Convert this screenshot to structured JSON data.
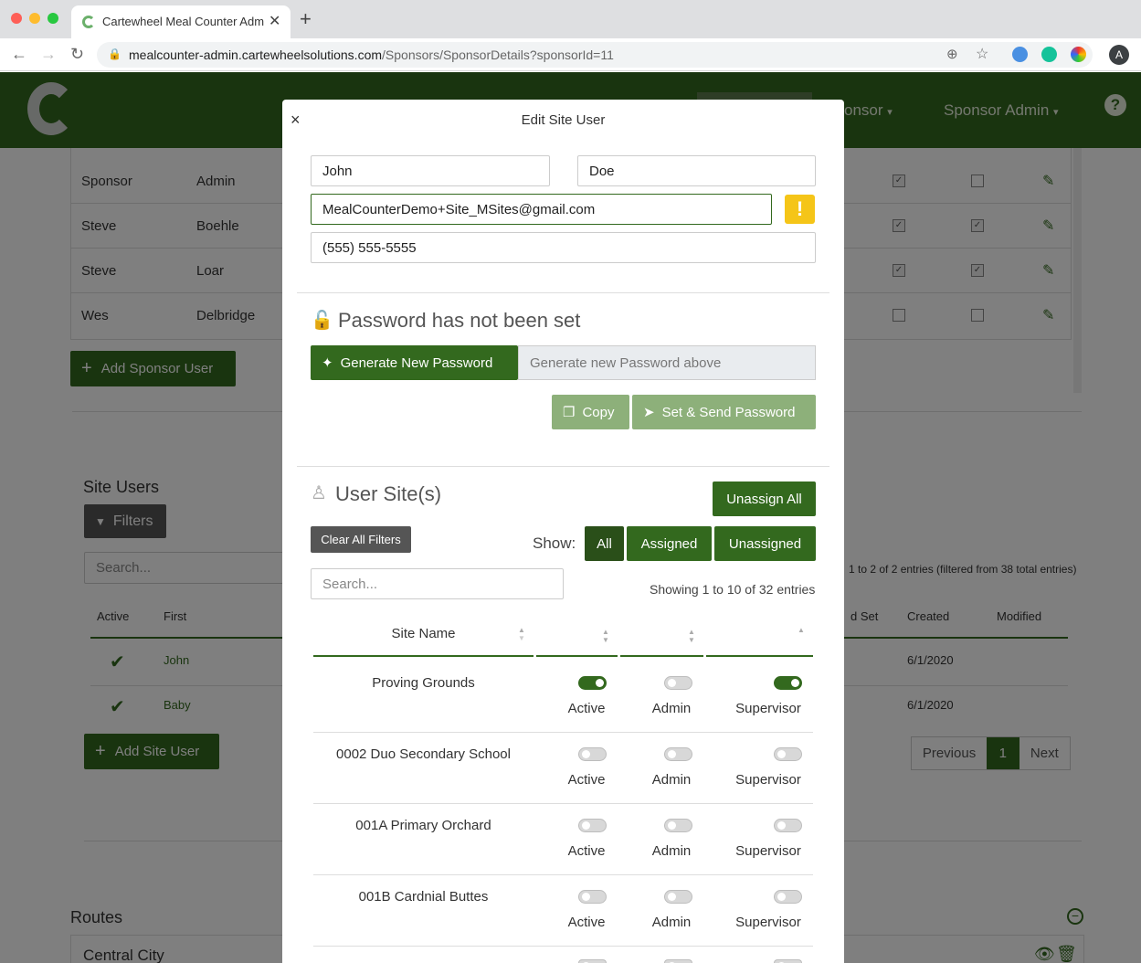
{
  "browser": {
    "tab_title": "Cartewheel Meal Counter Adm",
    "url_domain": "mealcounter-admin.cartewheelsolutions.com",
    "url_path": "/Sponsors/SponsorDetails?sponsorId=11",
    "profile_initial": "A"
  },
  "header": {
    "nav_sponsor": "onsor",
    "nav_admin": "Sponsor Admin",
    "help_icon": "?"
  },
  "background": {
    "sponsor_users": [
      {
        "first": "Sponsor",
        "last": "Admin"
      },
      {
        "first": "Steve",
        "last": "Boehle"
      },
      {
        "first": "Steve",
        "last": "Loar"
      },
      {
        "first": "Wes",
        "last": "Delbridge"
      }
    ],
    "add_sponsor_user": "Add Sponsor User",
    "site_users_title": "Site Users",
    "filters_label": "Filters",
    "search_placeholder": "Search...",
    "entries_info": "1 to 2 of 2 entries (filtered from 38 total entries)",
    "col_active": "Active",
    "col_first": "First",
    "col_pwset": "d Set",
    "col_created": "Created",
    "col_modified": "Modified",
    "site_users": [
      {
        "first": "John",
        "created": "6/1/2020"
      },
      {
        "first": "Baby",
        "created": "6/1/2020"
      }
    ],
    "add_site_user": "Add Site User",
    "prev": "Previous",
    "page": "1",
    "next": "Next",
    "routes_title": "Routes",
    "route_1": "Central City"
  },
  "modal": {
    "title": "Edit Site User",
    "close": "×",
    "first_name": "John",
    "last_name": "Doe",
    "email": "MealCounterDemo+Site_MSites@gmail.com",
    "warning_icon": "!",
    "phone": "(555) 555-5555",
    "password_heading": "Password has not been set",
    "generate_btn": "Generate New Password",
    "generate_placeholder": "Generate new Password above",
    "copy_btn": "Copy",
    "send_btn": "Set & Send Password",
    "sites_heading": "User Site(s)",
    "unassign_all": "Unassign All",
    "clear_filters": "Clear All Filters",
    "show_label": "Show:",
    "show_all": "All",
    "show_assigned": "Assigned",
    "show_unassigned": "Unassigned",
    "sites_search_placeholder": "Search...",
    "sites_info": "Showing 1 to 10 of 32 entries",
    "col_site_name": "Site Name",
    "label_active": "Active",
    "label_admin": "Admin",
    "label_supervisor": "Supervisor",
    "sites": [
      {
        "name": "Proving Grounds",
        "active": true,
        "admin": false,
        "supervisor": true
      },
      {
        "name": "0002 Duo Secondary School",
        "active": false,
        "admin": false,
        "supervisor": false
      },
      {
        "name": "001A Primary Orchard",
        "active": false,
        "admin": false,
        "supervisor": false
      },
      {
        "name": "001B Cardnial Buttes",
        "active": false,
        "admin": false,
        "supervisor": false
      }
    ]
  }
}
